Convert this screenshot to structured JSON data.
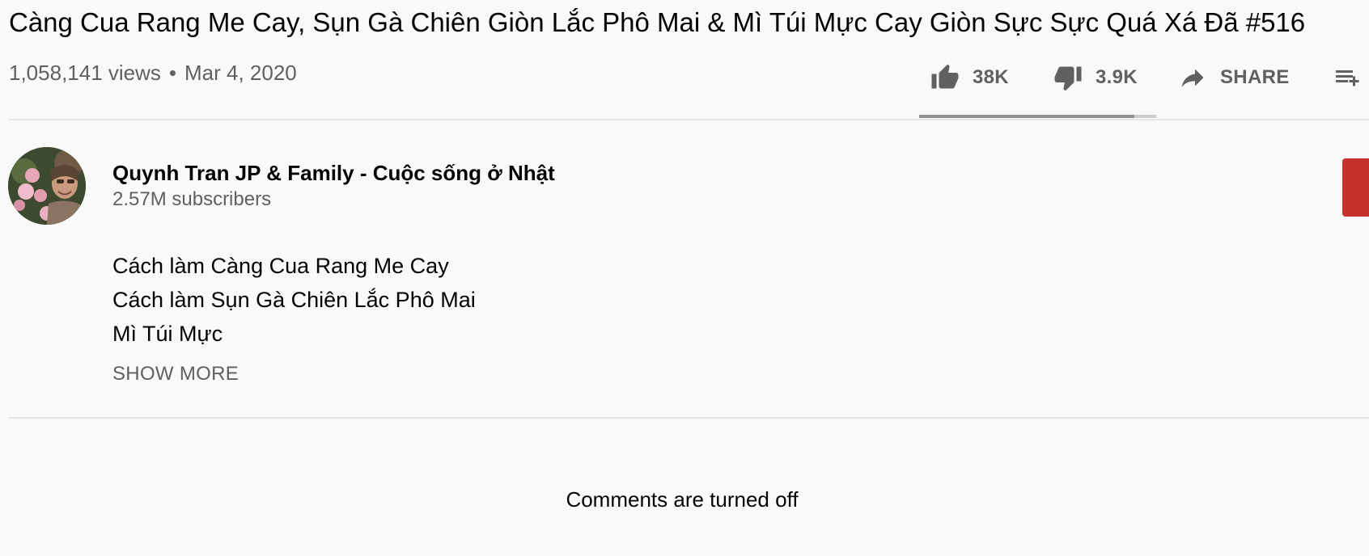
{
  "video": {
    "title": "Càng Cua Rang Me Cay, Sụn Gà Chiên Giòn Lắc Phô Mai & Mì Túi Mực Cay Giòn Sực Sực Quá Xá Đã #516",
    "views": "1,058,141 views",
    "separator": "•",
    "date": "Mar 4, 2020"
  },
  "actions": {
    "like_count": "38K",
    "dislike_count": "3.9K",
    "share_label": "SHARE",
    "like_ratio": 0.907
  },
  "icons": {
    "like": "thumbs-up-icon",
    "dislike": "thumbs-down-icon",
    "share": "share-arrow-icon",
    "save": "playlist-add-icon"
  },
  "channel": {
    "name": "Quynh Tran JP & Family - Cuộc sống ở Nhật",
    "subscribers": "2.57M subscribers"
  },
  "description": {
    "lines": [
      "Cách làm Càng Cua Rang Me Cay",
      "Cách làm Sụn Gà Chiên Lắc Phô Mai",
      "Mì Túi Mực"
    ],
    "show_more": "SHOW MORE"
  },
  "comments": {
    "status": "Comments are turned off"
  },
  "colors": {
    "background": "#f9f9f9",
    "text_primary": "#030303",
    "text_secondary": "#606060",
    "subscribe_red": "#c4302b",
    "divider": "#e5e5e5"
  }
}
